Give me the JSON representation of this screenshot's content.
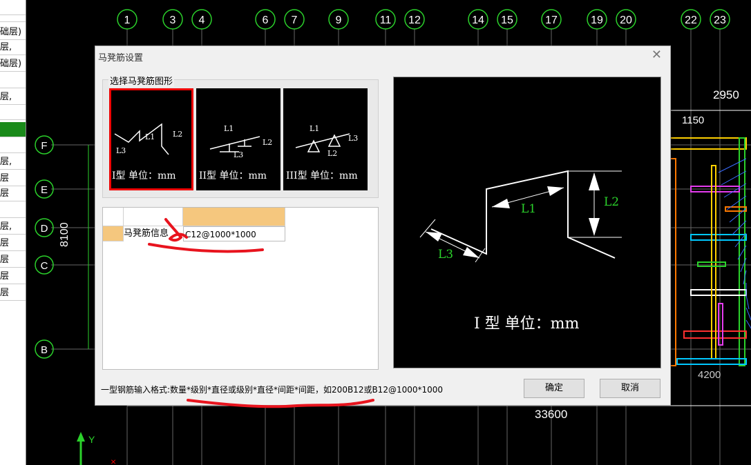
{
  "floor_panel": {
    "items": [
      "",
      "",
      "础层)",
      "层,",
      "础层)",
      "",
      "层,",
      "",
      "",
      "",
      "层,",
      "层",
      "层",
      "",
      "层,",
      "层",
      "层",
      "层",
      "层"
    ]
  },
  "cad": {
    "axis_numbers": [
      "1",
      "3",
      "4",
      "6",
      "7",
      "9",
      "11",
      "12",
      "14",
      "15",
      "17",
      "19",
      "20",
      "22",
      "23"
    ],
    "axis_letters": [
      "F",
      "E",
      "D",
      "C",
      "B"
    ],
    "dim_left": "8100",
    "dim_top_right": "2950",
    "dim_right_small": "1150",
    "dim_bottom": "33600",
    "dim_bottom_right": "4200",
    "ucs_y": "Y"
  },
  "dialog": {
    "title": "马凳筋设置",
    "close_icon": "close-icon",
    "shape_group_label": "选择马凳筋图形",
    "shapes": [
      {
        "caption": "I型 单位：mm",
        "selected": true,
        "l1": "L1",
        "l2": "L2",
        "l3": "L3"
      },
      {
        "caption": "II型 单位：mm",
        "selected": false,
        "l1": "L1",
        "l2": "L2",
        "l3": "L3"
      },
      {
        "caption": "III型 单位：mm",
        "selected": false,
        "l1": "L1",
        "l2": "L2",
        "l3": "L3"
      }
    ],
    "grid": {
      "row_label": "马凳筋信息",
      "row_value": "C12@1000*1000"
    },
    "preview": {
      "l1": "L1",
      "l2": "L2",
      "l3": "L3",
      "caption": "I 型  单位：mm"
    },
    "format_hint": "一型钢筋输入格式:数量*级别*直径或级别*直径*间距*间距，如200B12或B12@1000*1000",
    "ok_label": "确定",
    "cancel_label": "取消"
  },
  "colors": {
    "cad_background": "#000000",
    "axis_green": "#2bd12b",
    "selection_red": "#e00000",
    "grid_header_orange": "#f5c77e",
    "annotation_red": "#e8141e"
  }
}
